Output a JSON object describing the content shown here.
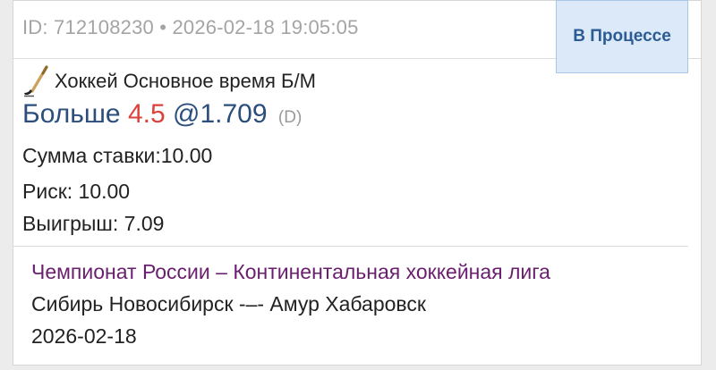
{
  "bet": {
    "meta": "ID: 712108230 • 2026-02-18 19:05:05",
    "status": "В Процессе",
    "sport_icon": "hockey-stick-icon",
    "market": "Хоккей Основное время Б/М",
    "selection": {
      "name": "Больше",
      "line": "4.5",
      "odds": "@1.709",
      "flag": "(D)"
    },
    "stake_line": "Сумма ставки:10.00",
    "risk_line": "Риск: 10.00",
    "win_line": "Выигрыш: 7.09"
  },
  "event": {
    "league": "Чемпионат России – Континентальная хоккейная лига",
    "teams": "Сибирь Новосибирск -–- Амур Хабаровск",
    "date": "2026-02-18"
  },
  "colors": {
    "selection_name": "#2b4e7c",
    "selection_line": "#d9433b",
    "league": "#6a1e6e",
    "status_bg": "#dbe9f8",
    "status_text": "#2d5b93"
  }
}
